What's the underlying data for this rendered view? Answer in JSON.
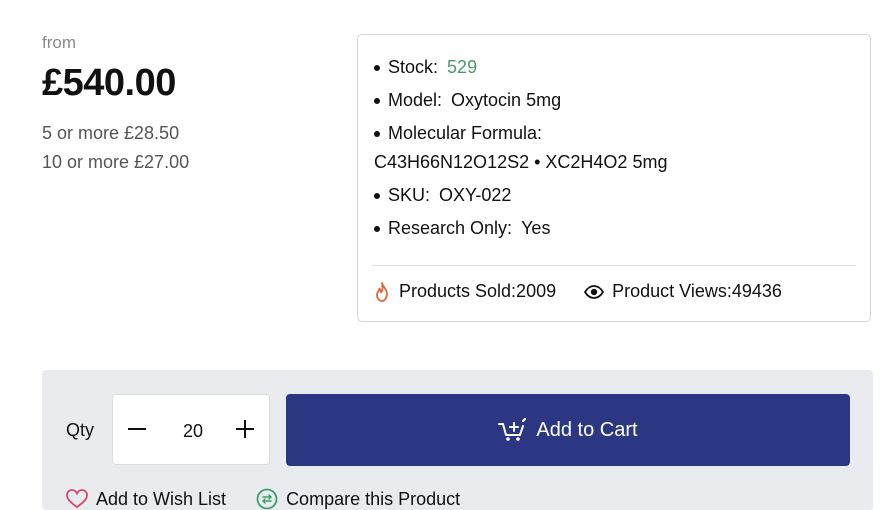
{
  "pricing": {
    "from_label": "from",
    "price": "£540.00",
    "tiers": [
      "5 or more £28.50",
      "10 or more £27.00"
    ]
  },
  "details": {
    "stock_label": "Stock:",
    "stock_value": "529",
    "model_label": "Model:",
    "model_value": "Oxytocin 5mg",
    "formula_label": "Molecular Formula:",
    "formula_value": "C43H66N12O12S2 • XC2H4O2 5mg",
    "sku_label": "SKU:",
    "sku_value": "OXY-022",
    "research_label": "Research Only:",
    "research_value": "Yes"
  },
  "stats": {
    "sold": "Products Sold:2009",
    "views": "Product Views:49436"
  },
  "cart": {
    "qty_label": "Qty",
    "qty_value": "20",
    "add_label": "Add to Cart"
  },
  "links": {
    "wishlist": "Add to Wish List",
    "compare": "Compare this Product"
  },
  "colors": {
    "accent": "#2c3783",
    "stock": "#4a9a6e",
    "flame": "#e0663a",
    "panel": "#eaebee"
  },
  "icons": [
    "flame-icon",
    "eye-icon",
    "minus-icon",
    "plus-icon",
    "cart-icon",
    "heart-icon",
    "compare-icon"
  ]
}
